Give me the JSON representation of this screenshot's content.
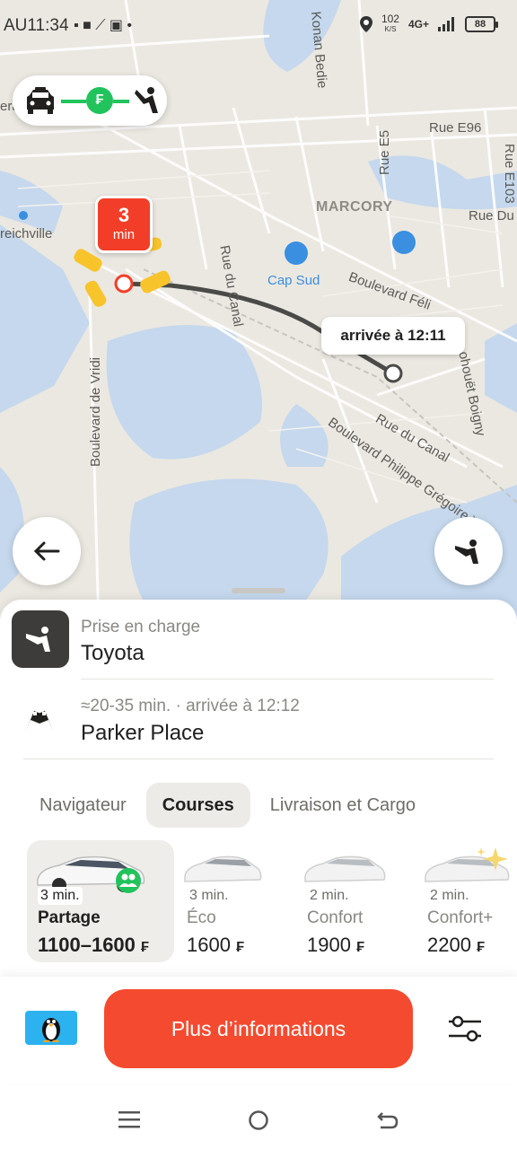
{
  "status_bar": {
    "time": "AU11:34",
    "left_icons": "▪ ■ ⟋ ▣ •",
    "speed": "102",
    "speed_unit": "K/S",
    "network": "4G+",
    "battery": "88"
  },
  "map": {
    "labels": {
      "konan_bedie": "Konan Bedie",
      "rue_e96": "Rue E96",
      "rue_e5": "Rue E5",
      "general_de_gaulle": "eral de Gaulle",
      "marcory": "MARCORY",
      "rue_du_b": "Rue Du B",
      "treichville": "reichville",
      "rue_du_canal": "Rue du Canal",
      "cap_sud": "Cap Sud",
      "boulevard_f": "Boulevard Féli",
      "houet_boigny": "ohouët Boigny",
      "boulevard_vridi": "Boulevard de Vridi",
      "rue_du_canal_2": "Rue du Canal",
      "bd_philippe": "Boulevard Philippe Grégoire Yacé",
      "rue_e103": "Rue E103"
    },
    "eta_minutes": "3",
    "eta_unit": "min",
    "arrival": "arrivée à 12:11",
    "route_currency_symbol": "₣",
    "route_color": "#21c35c"
  },
  "pickup": {
    "label": "Prise en charge",
    "value": "Toyota"
  },
  "destination": {
    "label": "≈20-35 min. · arrivée à 12:12",
    "value": "Parker Place"
  },
  "tabs": [
    {
      "label": "Navigateur",
      "active": false
    },
    {
      "label": "Courses",
      "active": true
    },
    {
      "label": "Livraison et Cargo",
      "active": false
    }
  ],
  "tariffs": [
    {
      "time": "3 min.",
      "name": "Partage",
      "price": "1100–1600",
      "currency": "₣",
      "selected": true
    },
    {
      "time": "3 min.",
      "name": "Éco",
      "price": "1600",
      "currency": "₣",
      "selected": false
    },
    {
      "time": "2 min.",
      "name": "Confort",
      "price": "1900",
      "currency": "₣",
      "selected": false
    },
    {
      "time": "2 min.",
      "name": "Confort+",
      "price": "2200",
      "currency": "₣",
      "selected": false
    }
  ],
  "cta": {
    "label": "Plus d’informations"
  },
  "colors": {
    "accent": "#f44a2f",
    "eta_pin": "#f23e28",
    "water": "#c6d9ee",
    "map_land": "#e9e6df"
  }
}
